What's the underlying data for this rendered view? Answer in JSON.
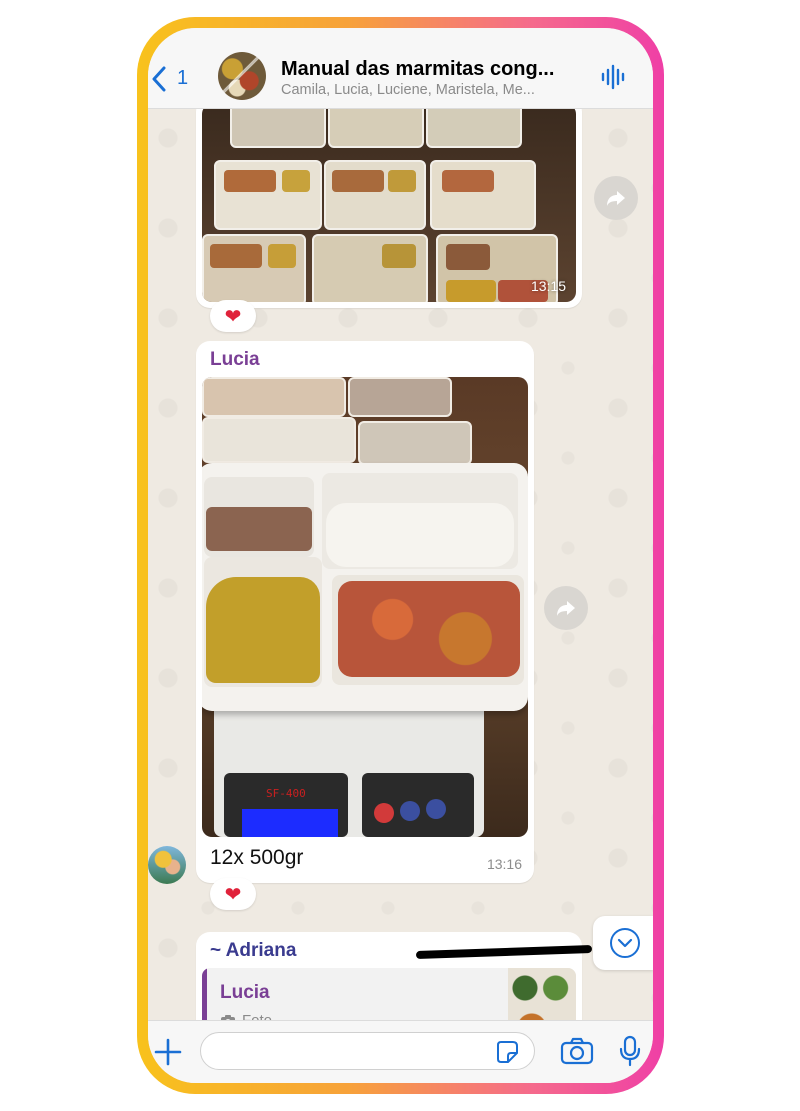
{
  "header": {
    "back_count": "1",
    "title": "Manual das marmitas cong...",
    "members": "Camila, Lucia, Luciene, Maristela, Me..."
  },
  "messages": [
    {
      "type": "image",
      "time": "13:15",
      "reaction": "❤"
    },
    {
      "sender": "Lucia",
      "sender_color": "#7a3f95",
      "type": "image",
      "caption": "12x 500gr",
      "time": "13:16",
      "reaction": "❤",
      "scale_label": "SF-400"
    },
    {
      "sender": "~ Adriana",
      "sender_color": "#3a3b8f",
      "quoted_sender": "Lucia",
      "quoted_text": "Foto"
    }
  ],
  "input": {
    "placeholder": ""
  },
  "colors": {
    "accent": "#1a6fd4",
    "heart": "#e0223a"
  },
  "icons": [
    "chevron-left-icon",
    "audio-wave-icon",
    "forward-icon",
    "heart-icon",
    "chevron-down-icon",
    "plus-icon",
    "sticker-icon",
    "camera-icon",
    "microphone-icon",
    "photo-icon"
  ]
}
